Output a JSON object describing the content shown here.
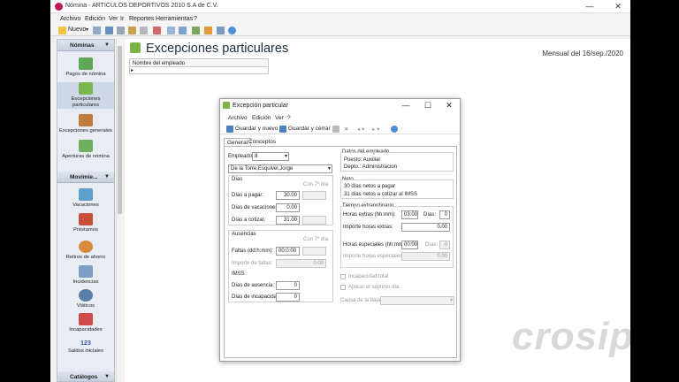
{
  "window": {
    "title": "Nómina - ARTICULOS DEPORTIVOS 2010 S.A de C.V.",
    "minimize": "—",
    "maximize": "☐",
    "close": "✕"
  },
  "menu": [
    "Archivo",
    "Edición",
    "Ver",
    "Ir",
    "Reportes",
    "Herramientas",
    "?"
  ],
  "toolbar": {
    "new_label": "Nuevo"
  },
  "sidebar": {
    "group1": "Nóminas",
    "group1_items": [
      "Pagos de nómina",
      "Excepciones particulares",
      "Excepciones generales",
      "Aperturas de nómina"
    ],
    "group2": "Movimie...",
    "group2_items": [
      "Vacaciones",
      "Préstamos",
      "Retiros de ahorro",
      "Incidencias",
      "Viáticos",
      "Incapacidades",
      "Saldos iniciales"
    ],
    "group3": "Catálogos",
    "counter_glyph": "123"
  },
  "main": {
    "title": "Excepciones particulares",
    "period": "Mensual del 16/sep./2020",
    "grid_header": "Nombre del empleado",
    "watermark": "crosip"
  },
  "dialog": {
    "title": "Excepción particular",
    "menu": [
      "Archivo",
      "Edición",
      "Ver",
      "?"
    ],
    "save_new": "Guardar y nuevo",
    "save_close": "Guardar y cerrar",
    "tabs": [
      "General",
      "Conceptos"
    ],
    "employee_label": "Empleado:",
    "employee_num": "8",
    "employee_name": "De la Torre,Esquivel,Jorge",
    "dias": {
      "legend": "Días",
      "col": "Con 7º día",
      "pagar_label": "Días a pagar:",
      "pagar": "30.00",
      "vacaciones_label": "Días de vacaciones:",
      "vacaciones": "0.00",
      "cotizar_label": "Días a cotizar:",
      "cotizar": "31.00"
    },
    "ausencias": {
      "legend": "Ausencias",
      "col": "Con 7º día",
      "faltas_label": "Faltas (dd:h:mm):",
      "faltas": "00:0:00",
      "importe_label": "Importe de faltas:",
      "importe": "0.00"
    },
    "imss": {
      "legend": "IMSS",
      "ausencia_label": "Días de ausencia:",
      "ausencia": "0",
      "incap_label": "Días de incapacidad:",
      "incap": "0"
    },
    "datos": {
      "legend": "Datos del empleado",
      "puesto": "Puesto:  Auxiliar",
      "depto": "Depto.:  Administracion"
    },
    "neto": {
      "legend": "Neto",
      "line1": "30 días netos a pagar",
      "line2": "31 días netos a cotizar al IMSS"
    },
    "tiempo": {
      "legend": "Tiempo extraordinario",
      "horas_label": "Horas extras (hh:mm):",
      "horas": "03:00",
      "dias_label": "Días:",
      "dias": "0",
      "importe_label": "Importe horas extras:",
      "importe": "0.00",
      "esp_label": "Horas especiales (hh:mm):",
      "esp": "00:00",
      "esp_dias_label": "Días:",
      "esp_dias": "0",
      "esp_importe_label": "Importe horas especiales:",
      "esp_importe": "0.00"
    },
    "incapacidad_total": "Incapacidad total",
    "septimo": "Aplicar el séptimo día",
    "causa_label": "Causa de la baja:"
  }
}
